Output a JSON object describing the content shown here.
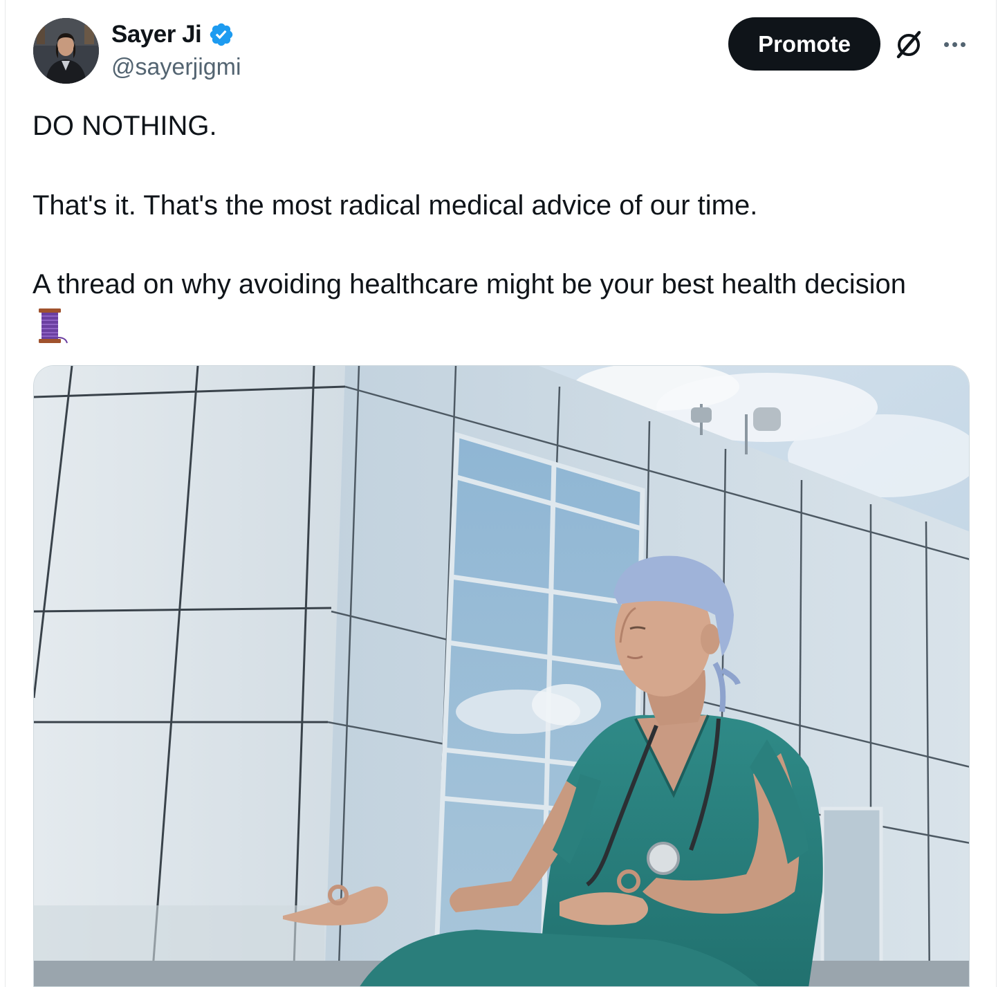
{
  "tweet": {
    "author_name": "Sayer Ji",
    "author_handle": "@sayerjigmi",
    "verified": true,
    "promote_label": "Promote",
    "paragraphs": [
      "DO NOTHING.",
      "That's it. That's the most radical medical advice of our time.",
      "A thread on why avoiding healthcare might be your best health decision"
    ],
    "trailing_emoji": "thread-spool-emoji"
  },
  "icons": {
    "verified": "verified-badge-icon",
    "grok": "grok-icon",
    "more": "more-options-icon"
  },
  "media": {
    "description_image": "photo-doctor-meditating"
  },
  "colors": {
    "text_primary": "#0f1419",
    "text_secondary": "#536471",
    "verified_blue": "#1d9bf0",
    "promote_bg": "#0f1419"
  }
}
